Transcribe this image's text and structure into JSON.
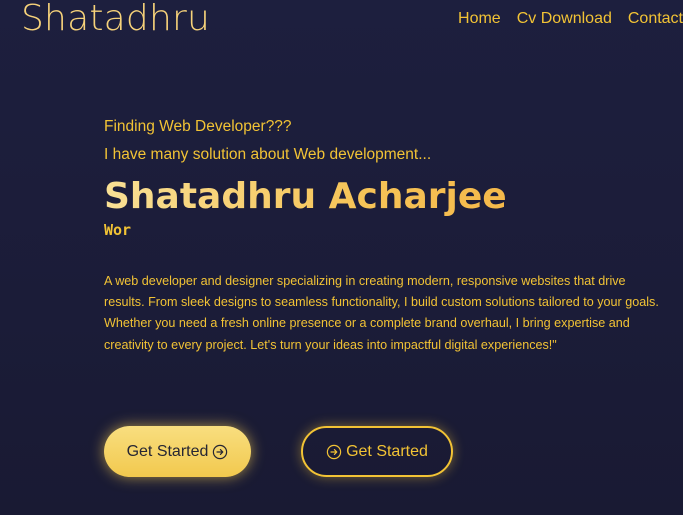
{
  "nav": {
    "logo": "Shatadhru",
    "items": [
      {
        "label": "Home"
      },
      {
        "label": "Cv Download"
      },
      {
        "label": "Contact"
      }
    ]
  },
  "hero": {
    "intro_line1": "Finding Web Developer???",
    "intro_line2": "I have many solution about Web development...",
    "name": "Shatadhru Acharjee",
    "typed_text": "Wor",
    "description": "A web developer and designer specializing in creating modern, responsive websites that drive results. From sleek designs to seamless functionality, I build custom solutions tailored to your goals. Whether you need a fresh online presence or a complete brand overhaul, I bring expertise and creativity to every project. Let's turn your ideas into impactful digital experiences!\""
  },
  "buttons": {
    "primary_label": "Get Started",
    "secondary_label": "Get Started",
    "icon": "circle-arrow-right-icon"
  },
  "colors": {
    "background": "#1d1f3e",
    "accent": "#f2c335",
    "button_gradient_start": "#f8de7f",
    "button_gradient_end": "#f2c94e"
  }
}
